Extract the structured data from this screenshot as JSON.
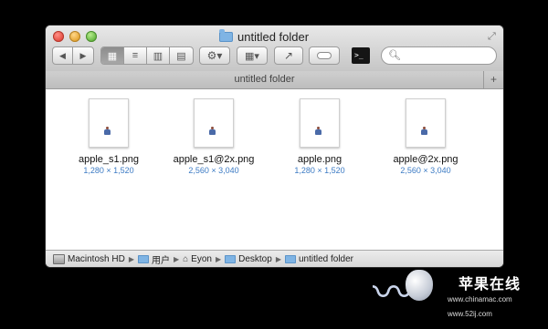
{
  "window": {
    "title": "untitled folder",
    "tab_label": "untitled folder",
    "tab_add": "+",
    "search_placeholder": "",
    "terminal_glyph": ">_"
  },
  "files": [
    {
      "name": "apple_s1.png",
      "dims": "1,280 × 1,520"
    },
    {
      "name": "apple_s1@2x.png",
      "dims": "2,560 × 3,040"
    },
    {
      "name": "apple.png",
      "dims": "1,280 × 1,520"
    },
    {
      "name": "apple@2x.png",
      "dims": "2,560 × 3,040"
    }
  ],
  "path": [
    "Macintosh HD",
    "用户",
    "Eyon",
    "Desktop",
    "untitled folder"
  ],
  "watermark": {
    "brand": "苹果在线",
    "url1": "www.chinamac.com",
    "url2": "www.52ij.com"
  },
  "colors": {
    "accent": "#3c7bc4",
    "folder": "#7fb4e4",
    "background": "#000000"
  }
}
